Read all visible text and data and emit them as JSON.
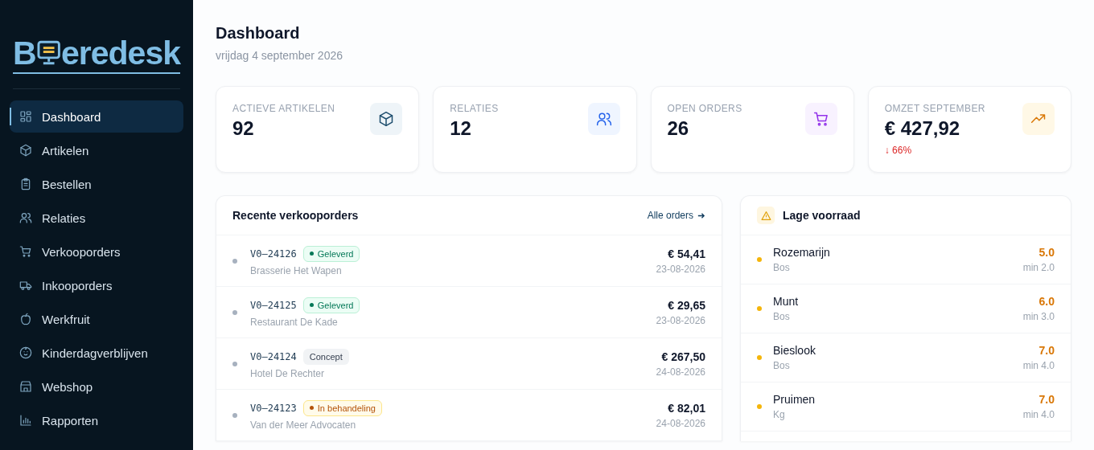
{
  "logo": {
    "text_before": "B",
    "text_after": "eredesk"
  },
  "sidebar": {
    "items": [
      {
        "label": "Dashboard",
        "selected": true
      },
      {
        "label": "Artikelen",
        "selected": false
      },
      {
        "label": "Bestellen",
        "selected": false
      },
      {
        "label": "Relaties",
        "selected": false
      },
      {
        "label": "Verkooporders",
        "selected": false
      },
      {
        "label": "Inkooporders",
        "selected": false
      },
      {
        "label": "Werkfruit",
        "selected": false
      },
      {
        "label": "Kinderdagverblijven",
        "selected": false
      },
      {
        "label": "Webshop",
        "selected": false
      },
      {
        "label": "Rapporten",
        "selected": false
      }
    ]
  },
  "header": {
    "title": "Dashboard",
    "date": "vrijdag 4 september 2026"
  },
  "stats": [
    {
      "label": "ACTIEVE ARTIKELEN",
      "value": "92"
    },
    {
      "label": "RELATIES",
      "value": "12"
    },
    {
      "label": "OPEN ORDERS",
      "value": "26"
    },
    {
      "label": "OMZET SEPTEMBER",
      "value": "€ 427,92",
      "change": "↓ 66%"
    }
  ],
  "orders": {
    "title": "Recente verkooporders",
    "link": "Alle orders",
    "rows": [
      {
        "number": "V0–24126",
        "status": "Geleverd",
        "kind": "delivered",
        "customer": "Brasserie Het Wapen",
        "amount": "€ 54,41",
        "date": "23-08-2026"
      },
      {
        "number": "V0–24125",
        "status": "Geleverd",
        "kind": "delivered",
        "customer": "Restaurant De Kade",
        "amount": "€ 29,65",
        "date": "23-08-2026"
      },
      {
        "number": "V0–24124",
        "status": "Concept",
        "kind": "draft",
        "customer": "Hotel De Rechter",
        "amount": "€ 267,50",
        "date": "24-08-2026"
      },
      {
        "number": "V0–24123",
        "status": "In behandeling",
        "kind": "processing",
        "customer": "Van der Meer Advocaten",
        "amount": "€ 82,01",
        "date": "24-08-2026"
      }
    ]
  },
  "low_stock": {
    "title": "Lage voorraad",
    "items": [
      {
        "name": "Rozemarijn",
        "unit": "Bos",
        "stock": "5.0",
        "minimum": "min 2.0"
      },
      {
        "name": "Munt",
        "unit": "Bos",
        "stock": "6.0",
        "minimum": "min 3.0"
      },
      {
        "name": "Bieslook",
        "unit": "Bos",
        "stock": "7.0",
        "minimum": "min 4.0"
      },
      {
        "name": "Pruimen",
        "unit": "Kg",
        "stock": "7.0",
        "minimum": "min 4.0"
      }
    ]
  }
}
